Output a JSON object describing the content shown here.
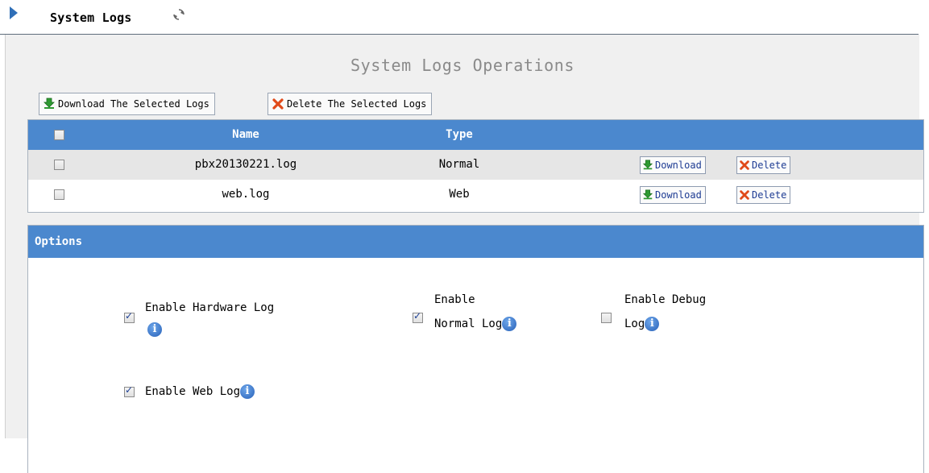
{
  "header": {
    "title": "System Logs"
  },
  "operations": {
    "title": "System Logs Operations",
    "download_selected_label": "Download The Selected Logs",
    "delete_selected_label": "Delete The Selected Logs"
  },
  "table": {
    "columns": [
      "Name",
      "Type"
    ],
    "rows": [
      {
        "name": "pbx20130221.log",
        "type": "Normal",
        "download_label": "Download",
        "delete_label": "Delete",
        "checked": false
      },
      {
        "name": "web.log",
        "type": "Web",
        "download_label": "Download",
        "delete_label": "Delete",
        "checked": false
      }
    ]
  },
  "options": {
    "title": "Options",
    "items": [
      {
        "line1": "Enable Hardware Log",
        "checked": true
      },
      {
        "line1": "Enable",
        "line2": "Normal Log",
        "checked": true
      },
      {
        "line1": "Enable Debug",
        "line2": "Log",
        "checked": false
      },
      {
        "line1": "Enable Web Log",
        "checked": true
      }
    ]
  },
  "colors": {
    "header_blue": "#4b88ce",
    "panel_gray": "#f0f0f0",
    "delete_red": "#e04a1a",
    "download_green": "#2e9a32"
  }
}
